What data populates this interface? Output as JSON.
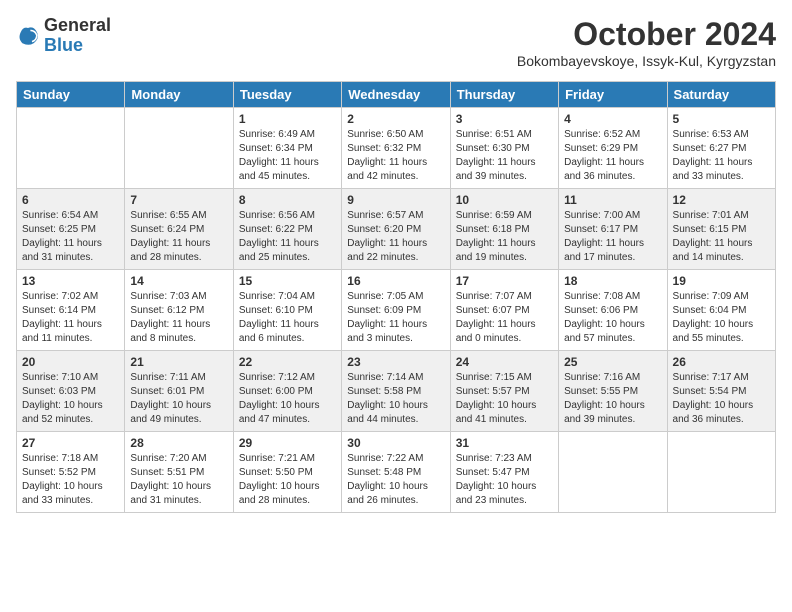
{
  "header": {
    "logo_general": "General",
    "logo_blue": "Blue",
    "month_title": "October 2024",
    "location": "Bokombayevskoye, Issyk-Kul, Kyrgyzstan"
  },
  "weekdays": [
    "Sunday",
    "Monday",
    "Tuesday",
    "Wednesday",
    "Thursday",
    "Friday",
    "Saturday"
  ],
  "weeks": [
    [
      {
        "day": "",
        "info": ""
      },
      {
        "day": "",
        "info": ""
      },
      {
        "day": "1",
        "info": "Sunrise: 6:49 AM\nSunset: 6:34 PM\nDaylight: 11 hours and 45 minutes."
      },
      {
        "day": "2",
        "info": "Sunrise: 6:50 AM\nSunset: 6:32 PM\nDaylight: 11 hours and 42 minutes."
      },
      {
        "day": "3",
        "info": "Sunrise: 6:51 AM\nSunset: 6:30 PM\nDaylight: 11 hours and 39 minutes."
      },
      {
        "day": "4",
        "info": "Sunrise: 6:52 AM\nSunset: 6:29 PM\nDaylight: 11 hours and 36 minutes."
      },
      {
        "day": "5",
        "info": "Sunrise: 6:53 AM\nSunset: 6:27 PM\nDaylight: 11 hours and 33 minutes."
      }
    ],
    [
      {
        "day": "6",
        "info": "Sunrise: 6:54 AM\nSunset: 6:25 PM\nDaylight: 11 hours and 31 minutes."
      },
      {
        "day": "7",
        "info": "Sunrise: 6:55 AM\nSunset: 6:24 PM\nDaylight: 11 hours and 28 minutes."
      },
      {
        "day": "8",
        "info": "Sunrise: 6:56 AM\nSunset: 6:22 PM\nDaylight: 11 hours and 25 minutes."
      },
      {
        "day": "9",
        "info": "Sunrise: 6:57 AM\nSunset: 6:20 PM\nDaylight: 11 hours and 22 minutes."
      },
      {
        "day": "10",
        "info": "Sunrise: 6:59 AM\nSunset: 6:18 PM\nDaylight: 11 hours and 19 minutes."
      },
      {
        "day": "11",
        "info": "Sunrise: 7:00 AM\nSunset: 6:17 PM\nDaylight: 11 hours and 17 minutes."
      },
      {
        "day": "12",
        "info": "Sunrise: 7:01 AM\nSunset: 6:15 PM\nDaylight: 11 hours and 14 minutes."
      }
    ],
    [
      {
        "day": "13",
        "info": "Sunrise: 7:02 AM\nSunset: 6:14 PM\nDaylight: 11 hours and 11 minutes."
      },
      {
        "day": "14",
        "info": "Sunrise: 7:03 AM\nSunset: 6:12 PM\nDaylight: 11 hours and 8 minutes."
      },
      {
        "day": "15",
        "info": "Sunrise: 7:04 AM\nSunset: 6:10 PM\nDaylight: 11 hours and 6 minutes."
      },
      {
        "day": "16",
        "info": "Sunrise: 7:05 AM\nSunset: 6:09 PM\nDaylight: 11 hours and 3 minutes."
      },
      {
        "day": "17",
        "info": "Sunrise: 7:07 AM\nSunset: 6:07 PM\nDaylight: 11 hours and 0 minutes."
      },
      {
        "day": "18",
        "info": "Sunrise: 7:08 AM\nSunset: 6:06 PM\nDaylight: 10 hours and 57 minutes."
      },
      {
        "day": "19",
        "info": "Sunrise: 7:09 AM\nSunset: 6:04 PM\nDaylight: 10 hours and 55 minutes."
      }
    ],
    [
      {
        "day": "20",
        "info": "Sunrise: 7:10 AM\nSunset: 6:03 PM\nDaylight: 10 hours and 52 minutes."
      },
      {
        "day": "21",
        "info": "Sunrise: 7:11 AM\nSunset: 6:01 PM\nDaylight: 10 hours and 49 minutes."
      },
      {
        "day": "22",
        "info": "Sunrise: 7:12 AM\nSunset: 6:00 PM\nDaylight: 10 hours and 47 minutes."
      },
      {
        "day": "23",
        "info": "Sunrise: 7:14 AM\nSunset: 5:58 PM\nDaylight: 10 hours and 44 minutes."
      },
      {
        "day": "24",
        "info": "Sunrise: 7:15 AM\nSunset: 5:57 PM\nDaylight: 10 hours and 41 minutes."
      },
      {
        "day": "25",
        "info": "Sunrise: 7:16 AM\nSunset: 5:55 PM\nDaylight: 10 hours and 39 minutes."
      },
      {
        "day": "26",
        "info": "Sunrise: 7:17 AM\nSunset: 5:54 PM\nDaylight: 10 hours and 36 minutes."
      }
    ],
    [
      {
        "day": "27",
        "info": "Sunrise: 7:18 AM\nSunset: 5:52 PM\nDaylight: 10 hours and 33 minutes."
      },
      {
        "day": "28",
        "info": "Sunrise: 7:20 AM\nSunset: 5:51 PM\nDaylight: 10 hours and 31 minutes."
      },
      {
        "day": "29",
        "info": "Sunrise: 7:21 AM\nSunset: 5:50 PM\nDaylight: 10 hours and 28 minutes."
      },
      {
        "day": "30",
        "info": "Sunrise: 7:22 AM\nSunset: 5:48 PM\nDaylight: 10 hours and 26 minutes."
      },
      {
        "day": "31",
        "info": "Sunrise: 7:23 AM\nSunset: 5:47 PM\nDaylight: 10 hours and 23 minutes."
      },
      {
        "day": "",
        "info": ""
      },
      {
        "day": "",
        "info": ""
      }
    ]
  ]
}
